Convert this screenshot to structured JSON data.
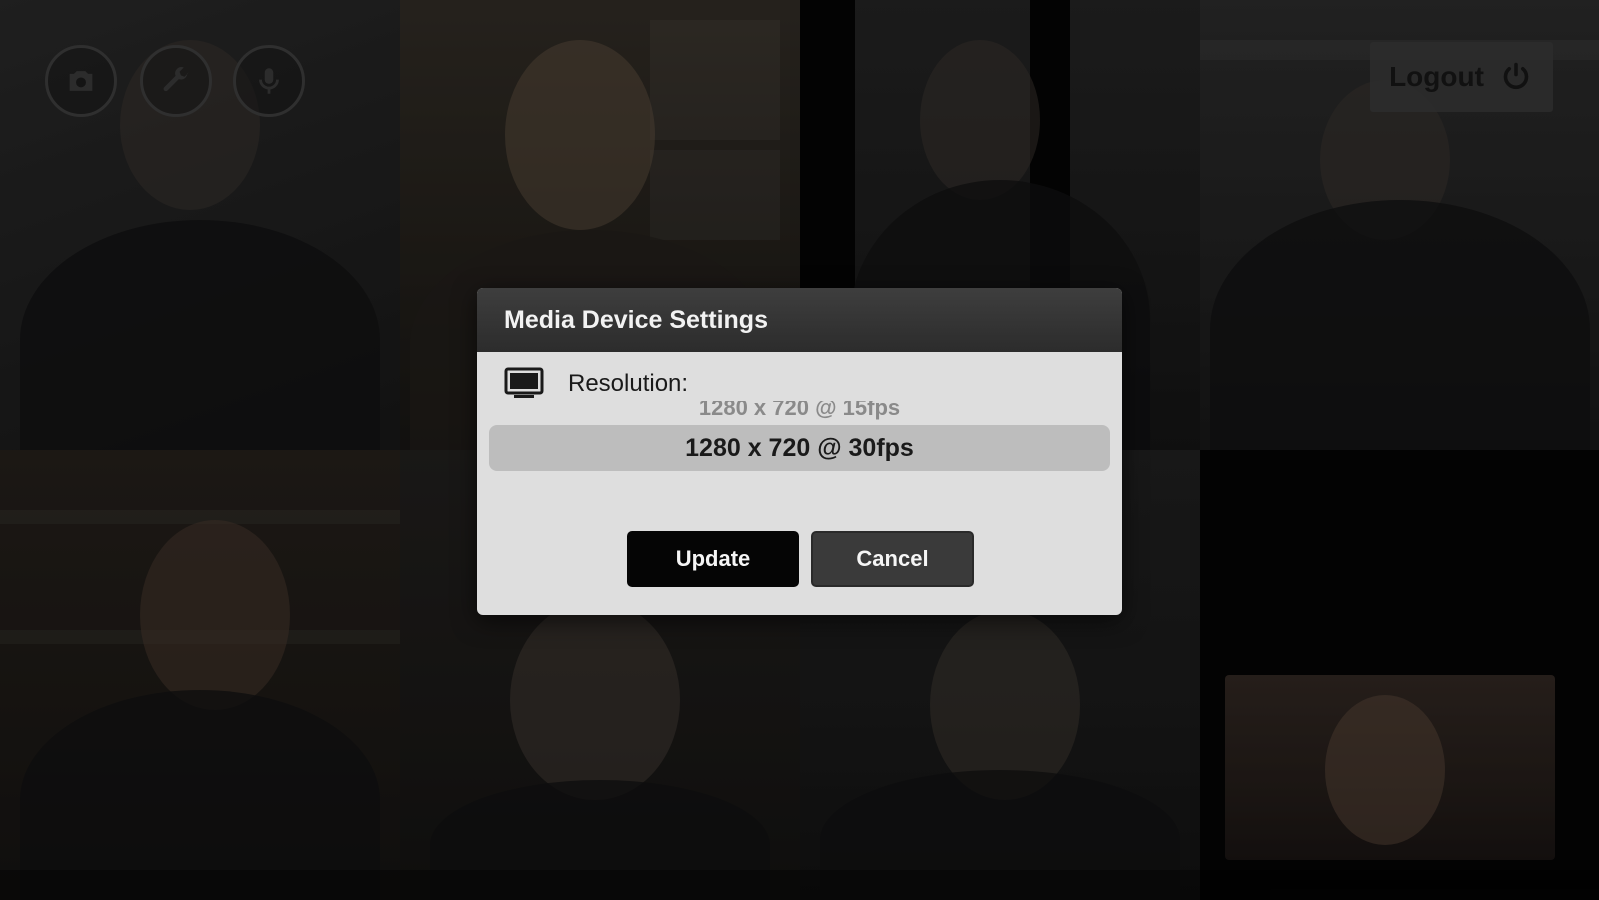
{
  "top_controls": {
    "camera_icon": "camera-icon",
    "settings_icon": "wrench-icon",
    "mic_icon": "microphone-icon"
  },
  "logout": {
    "label": "Logout",
    "icon": "power-icon"
  },
  "modal": {
    "title": "Media Device Settings",
    "resolution_label": "Resolution:",
    "monitor_icon": "monitor-icon",
    "options": {
      "previous": "1280 x 720 @ 15fps",
      "selected": "1280 x 720 @ 30fps"
    },
    "update_label": "Update",
    "cancel_label": "Cancel"
  },
  "colors": {
    "modal_bg": "#dedede",
    "header_bg": "#333333",
    "selected_bg": "#bdbdbd",
    "update_bg": "#050505",
    "cancel_bg": "#3a3a3a"
  }
}
